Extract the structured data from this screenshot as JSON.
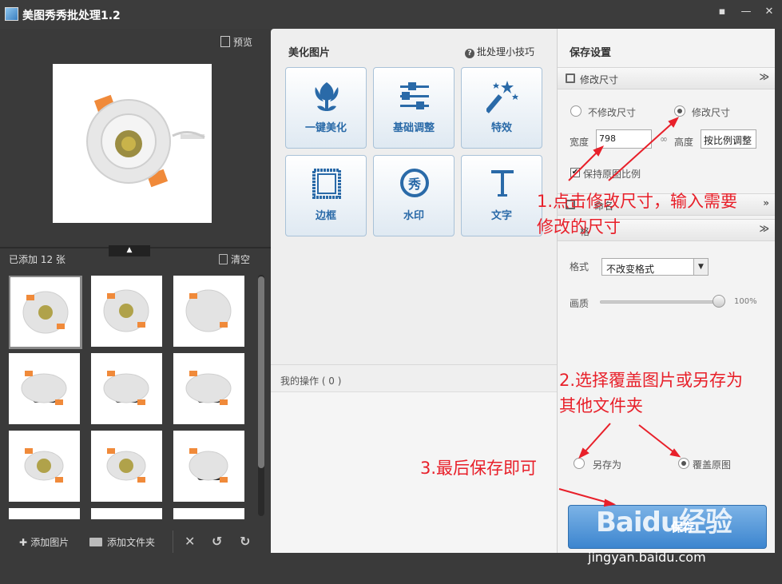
{
  "window": {
    "title": "美图秀秀批处理1.2"
  },
  "left_panel": {
    "preview_label": "预览",
    "added_count": "已添加 12 张",
    "clear_label": "清空",
    "add_image_label": "添加图片",
    "add_folder_label": "添加文件夹",
    "thumbnail_count": 12
  },
  "middle_panel": {
    "title": "美化图片",
    "tips_label": "批处理小技巧",
    "tools": [
      {
        "label": "一键美化",
        "icon": "tulip-icon"
      },
      {
        "label": "基础调整",
        "icon": "sliders-icon"
      },
      {
        "label": "特效",
        "icon": "magic-wand-icon"
      },
      {
        "label": "边框",
        "icon": "frame-icon"
      },
      {
        "label": "水印",
        "icon": "watermark-seal-icon"
      },
      {
        "label": "文字",
        "icon": "text-T-icon"
      }
    ],
    "ops_label": "我的操作 ( 0 )"
  },
  "right_panel": {
    "title": "保存设置",
    "resize_section": "修改尺寸",
    "no_resize_label": "不修改尺寸",
    "resize_label": "修改尺寸",
    "width_label": "宽度",
    "width_value": "798",
    "height_label": "高度",
    "height_value": "按比例调整",
    "keep_ratio_label": "保持原图比例",
    "rename_section_partial": "命名",
    "format_section_partial": "格",
    "format_label": "格式",
    "format_value": "不改变格式",
    "quality_label": "画质",
    "quality_value": "100%",
    "quality_level": 1.0,
    "save_as_label": "另存为",
    "overwrite_label": "覆盖原图",
    "save_button": "保存",
    "resize_selected": true,
    "overwrite_selected": true,
    "keep_ratio_checked": true
  },
  "annotations": {
    "step1": "1.点击修改尺寸，输入需要修改的尺寸",
    "step1_line1": "1.点击修改尺寸，输入需要",
    "step1_line2": "修改的尺寸",
    "step2_line1": "2.选择覆盖图片或另存为",
    "step2_line2": "其他文件夹",
    "step3": "3.最后保存即可"
  },
  "watermark": {
    "brand": "Baidu经验",
    "url": "jingyan.baidu.com"
  },
  "colors": {
    "accent": "#2a6aa8",
    "annotation": "#e8202a",
    "save_button": "#4a90d9"
  }
}
